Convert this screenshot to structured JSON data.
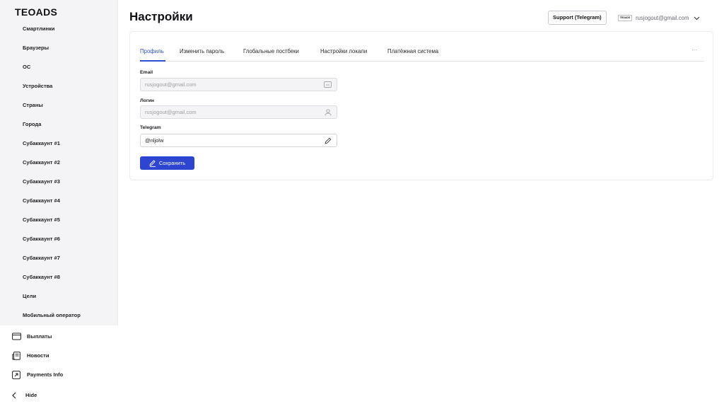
{
  "brand": {
    "logo": "TEOADS"
  },
  "sidebar": {
    "sub_items": [
      "Смартлинки",
      "Браузеры",
      "ОС",
      "Устройства",
      "Страны",
      "Города",
      "Субаккаунт #1",
      "Субаккаунт #2",
      "Субаккаунт #3",
      "Субаккаунт #4",
      "Субаккаунт #5",
      "Субаккаунт #6",
      "Субаккаунт #7",
      "Субаккаунт #8",
      "Цели",
      "Мобильный оператор"
    ],
    "nav": [
      {
        "label": "Выплаты",
        "icon": "wallet-icon"
      },
      {
        "label": "Новости",
        "icon": "news-icon"
      },
      {
        "label": "Payments Info",
        "icon": "external-link-icon"
      }
    ],
    "hide_label": "Hide"
  },
  "header": {
    "title": "Настройки",
    "support_label": "Support (Telegram)",
    "avatar_text": "TEOADS",
    "user_email": "rusjogout@gmail.com"
  },
  "tabs": {
    "items": [
      "Профиль",
      "Изменить пароль",
      "Глобальные постбеки",
      "Настройки локали",
      "Платёжная система"
    ],
    "active": "Профиль",
    "more": "···"
  },
  "form": {
    "email": {
      "label": "Email",
      "value": "rusjogout@gmail.com"
    },
    "login": {
      "label": "Логин",
      "value": "rusjogout@gmail.com"
    },
    "telegram": {
      "label": "Telegram",
      "value": "@nljolw"
    },
    "save_label": "Сохранить"
  },
  "colors": {
    "accent": "#2d45d1",
    "active_tab": "#2d4fd6",
    "sidebar_bg": "#f4f4f6"
  }
}
